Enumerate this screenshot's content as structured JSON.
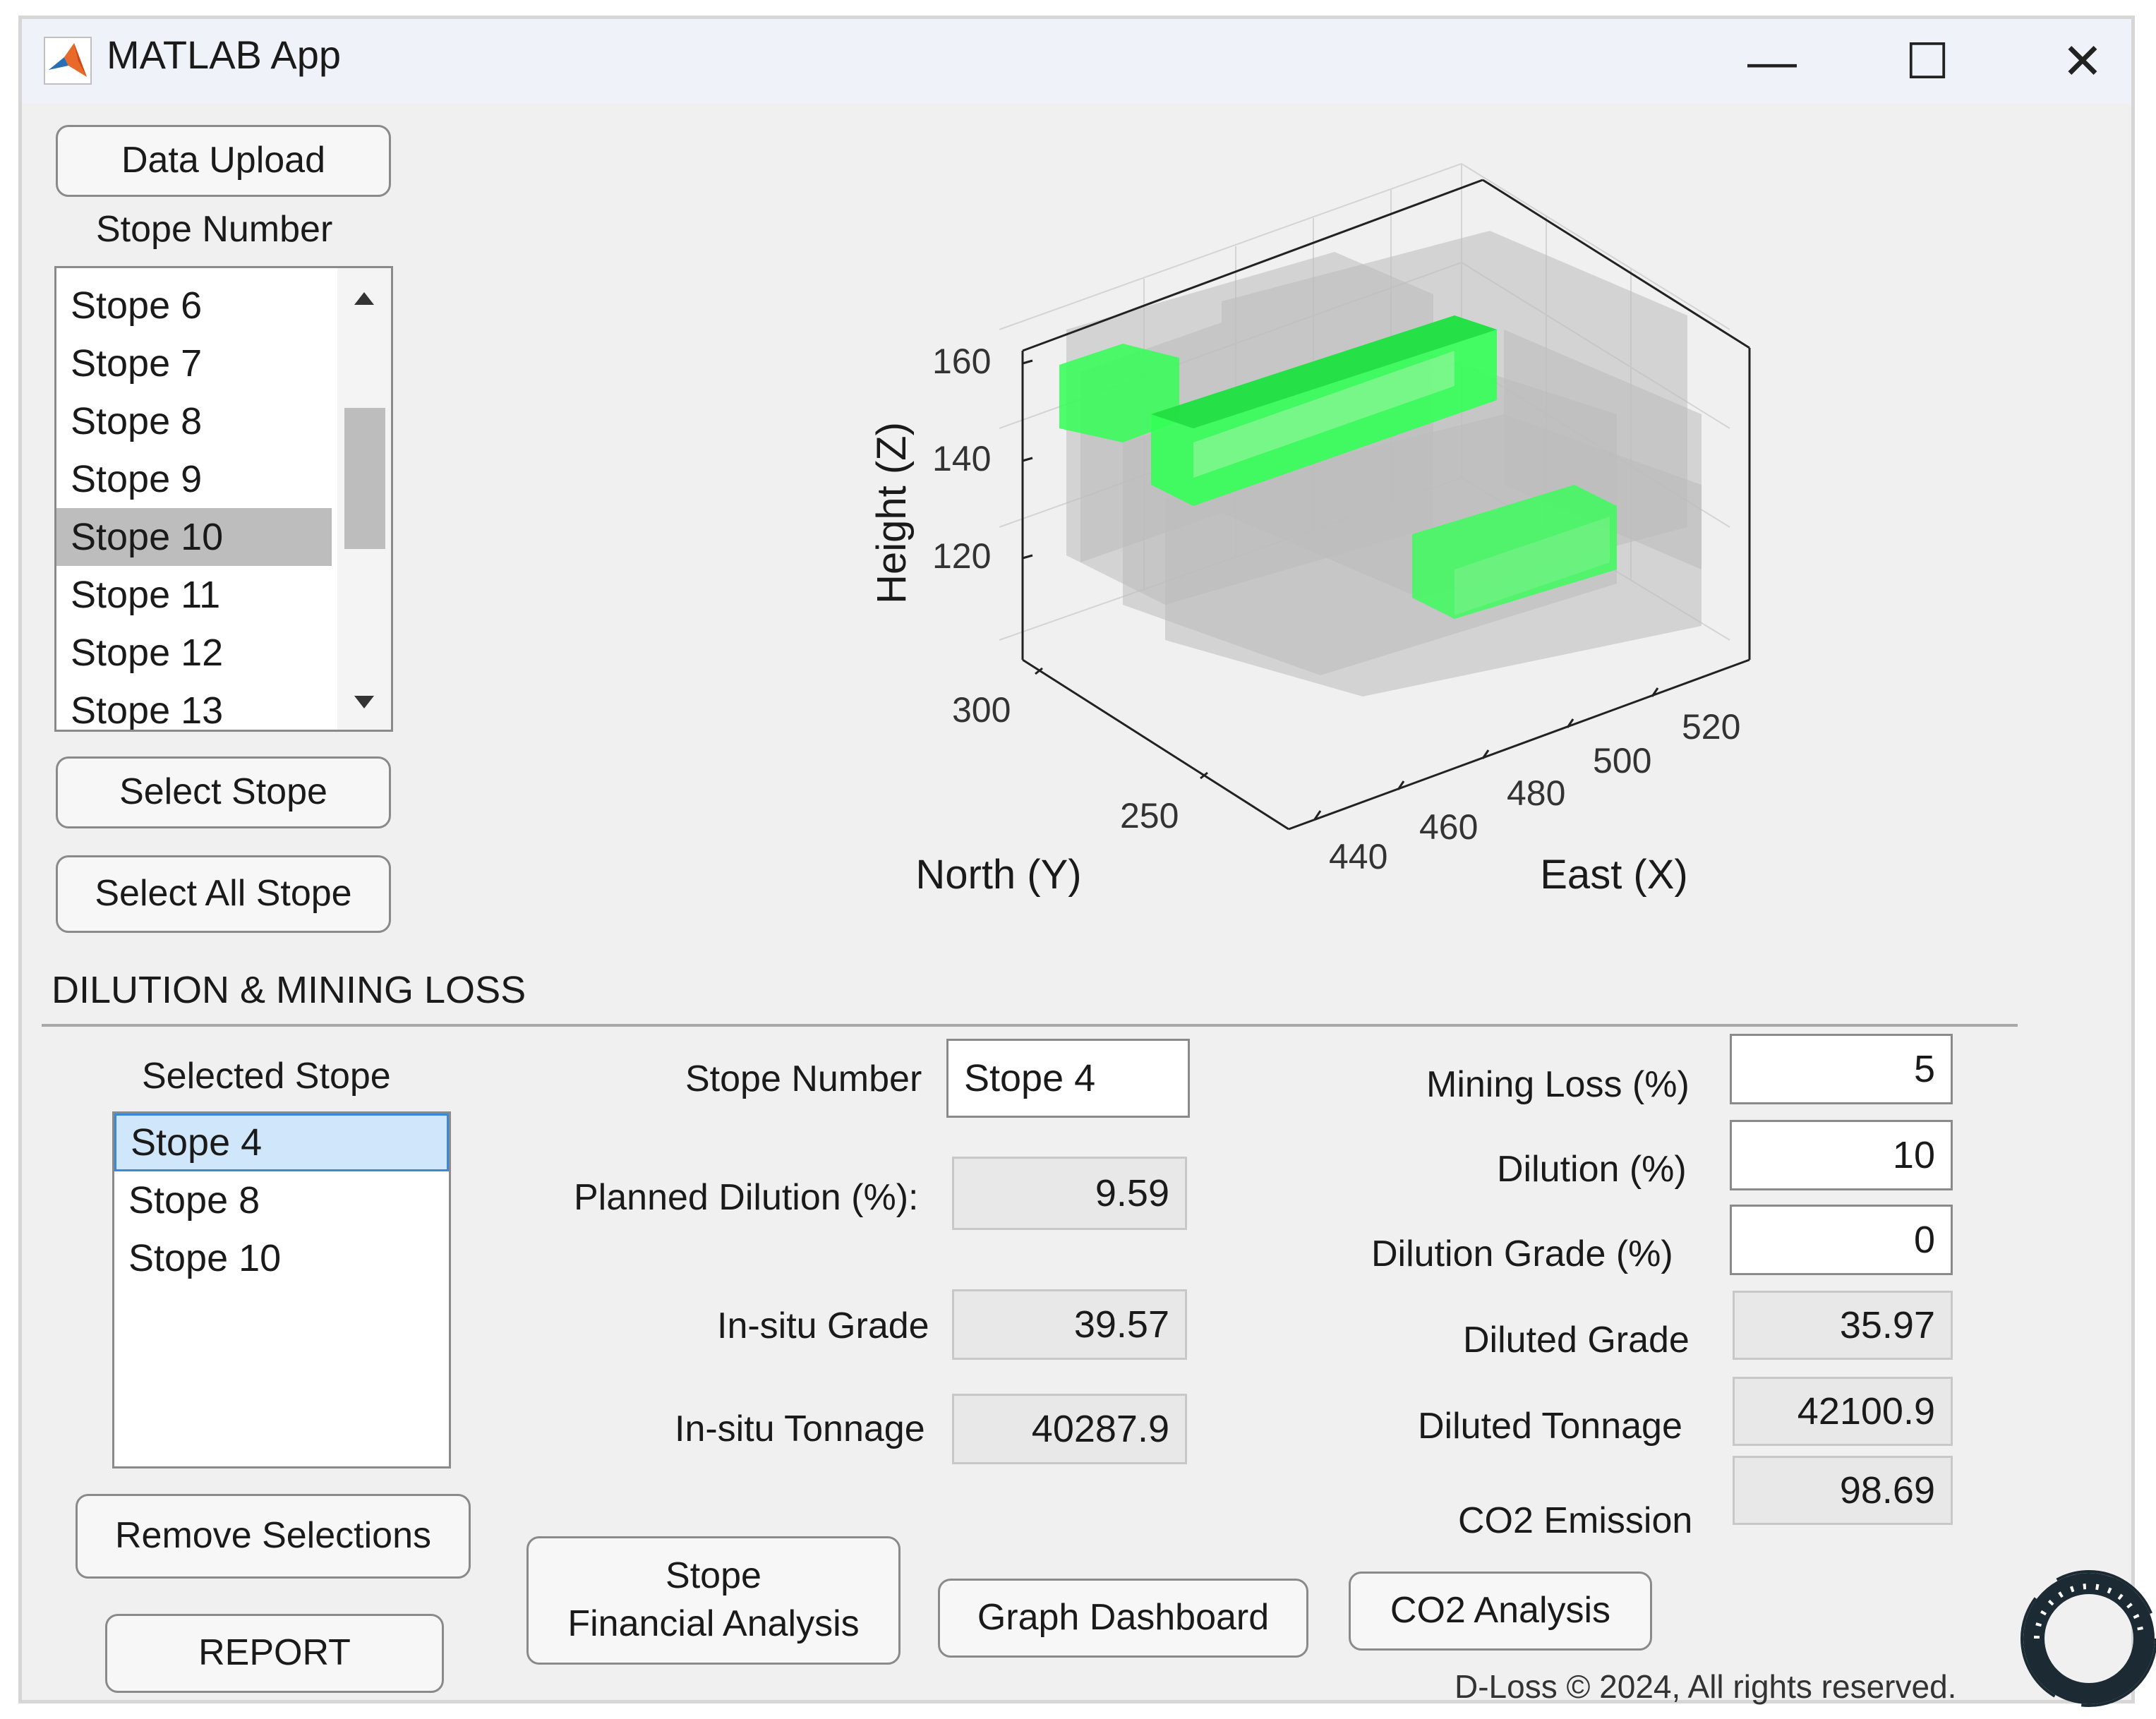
{
  "window": {
    "title": "MATLAB App",
    "minimize": "—",
    "maximize": "☐",
    "close": "✕"
  },
  "left_panel": {
    "data_upload": "Data Upload",
    "stope_number_label": "Stope Number",
    "stope_list": [
      "Stope  6",
      "Stope  7",
      "Stope  8",
      "Stope  9",
      "Stope 10",
      "Stope 11",
      "Stope 12",
      "Stope 13"
    ],
    "stope_list_selected": "Stope 10",
    "select_stope": "Select Stope",
    "select_all_stope": "Select All Stope"
  },
  "plot": {
    "z_label": "Height (Z)",
    "y_label": "North (Y)",
    "x_label": "East (X)",
    "z_ticks": [
      "160",
      "140",
      "120"
    ],
    "y_ticks": [
      "300",
      "250"
    ],
    "x_ticks": [
      "440",
      "460",
      "480",
      "500",
      "520"
    ],
    "highlight_color": "#33ff55",
    "block_color": "#c8c8c8"
  },
  "section": {
    "title": "DILUTION & MINING LOSS"
  },
  "selected": {
    "label": "Selected Stope",
    "items": [
      "Stope  4",
      "Stope  8",
      "Stope 10"
    ],
    "active": "Stope  4"
  },
  "middle": {
    "stope_number_label": "Stope Number",
    "stope_number_value": "Stope  4",
    "planned_dilution_label": "Planned Dilution (%):",
    "planned_dilution_value": "9.59",
    "insitu_grade_label": "In-situ Grade",
    "insitu_grade_value": "39.57",
    "insitu_tonnage_label": "In-situ Tonnage",
    "insitu_tonnage_value": "40287.9"
  },
  "right": {
    "mining_loss_label": "Mining Loss (%)",
    "mining_loss_value": "5",
    "dilution_label": "Dilution (%)",
    "dilution_value": "10",
    "dilution_grade_label": "Dilution Grade (%)",
    "dilution_grade_value": "0",
    "diluted_grade_label": "Diluted Grade",
    "diluted_grade_value": "35.97",
    "diluted_tonnage_label": "Diluted Tonnage",
    "diluted_tonnage_value": "42100.9",
    "co2_label": "CO2 Emission",
    "co2_value": "98.69"
  },
  "buttons": {
    "remove_selections": "Remove Selections",
    "report": "REPORT",
    "stope_financial_1": "Stope",
    "stope_financial_2": "Financial Analysis",
    "graph_dashboard": "Graph Dashboard",
    "co2_analysis": "CO2 Analysis"
  },
  "footer": {
    "copyright": "D-Loss ©  2024, All rights reserved."
  }
}
